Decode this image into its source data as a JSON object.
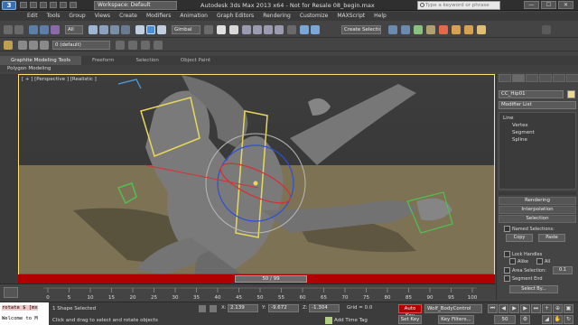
{
  "titlebar": {
    "logo": "3",
    "workspace": "Workspace: Default",
    "title": "Autodesk 3ds Max  2013 x64  -  Not for Resale    08_begin.max",
    "search_placeholder": "Type a keyword or phrase",
    "buttons": [
      "—",
      "☐",
      "✕"
    ]
  },
  "menu": [
    "Edit",
    "Tools",
    "Group",
    "Views",
    "Create",
    "Modifiers",
    "Animation",
    "Graph Editors",
    "Rendering",
    "Customize",
    "MAXScript",
    "Help"
  ],
  "toolbar": {
    "selection_filter": "All",
    "refcoord": "Gimbal",
    "named_selection": "Create Selection S",
    "layer": "0 (default)"
  },
  "ribbon": {
    "tabs": [
      "Graphite Modeling Tools",
      "Freeform",
      "Selection",
      "Object Paint"
    ],
    "active_tab": "Graphite Modeling Tools",
    "sub_label": "Polygon Modeling"
  },
  "viewport": {
    "label": "[ + ] [Perspective ] [Realistic ]",
    "time_slider": "50 / 99"
  },
  "command_panel": {
    "object_name": "CC_Hip01",
    "object_color": "#f0d88a",
    "modifier_list": "Modifier List",
    "stack": [
      "Line",
      "Vertex",
      "Segment",
      "Spline"
    ],
    "rollouts": [
      "Rendering",
      "Interpolation",
      "Selection"
    ],
    "named_selections": "Named Selections:",
    "copy": "Copy",
    "paste": "Paste",
    "lock_handles": "Lock Handles",
    "alike": "Alike",
    "all": "All",
    "area_selection": "Area Selection:",
    "area_value": "0.1",
    "segment_end": "Segment End",
    "select_by": "Select By..."
  },
  "trackbar": {
    "ticks": [
      "0",
      "5",
      "10",
      "15",
      "20",
      "25",
      "30",
      "35",
      "40",
      "45",
      "50",
      "55",
      "60",
      "65",
      "70",
      "75",
      "80",
      "85",
      "90",
      "95",
      "100"
    ]
  },
  "status": {
    "maxscript_1": "rotate $ [mx",
    "maxscript_2": "Welcome to M",
    "line1": "1 Shape Selected",
    "line2": "Click and drag to select and rotate objects",
    "x_label": "X:",
    "x_value": "2.139",
    "y_label": "Y:",
    "y_value": "-9.672",
    "z_label": "Z:",
    "z_value": "-1.304",
    "grid": "Grid = 0.0",
    "add_time_tag": "Add Time Tag",
    "auto_key": "Auto Key",
    "set_key": "Set Key",
    "selection_set": "Wolf_BodyControl",
    "key_filters": "Key Filters...",
    "frame": "50"
  }
}
